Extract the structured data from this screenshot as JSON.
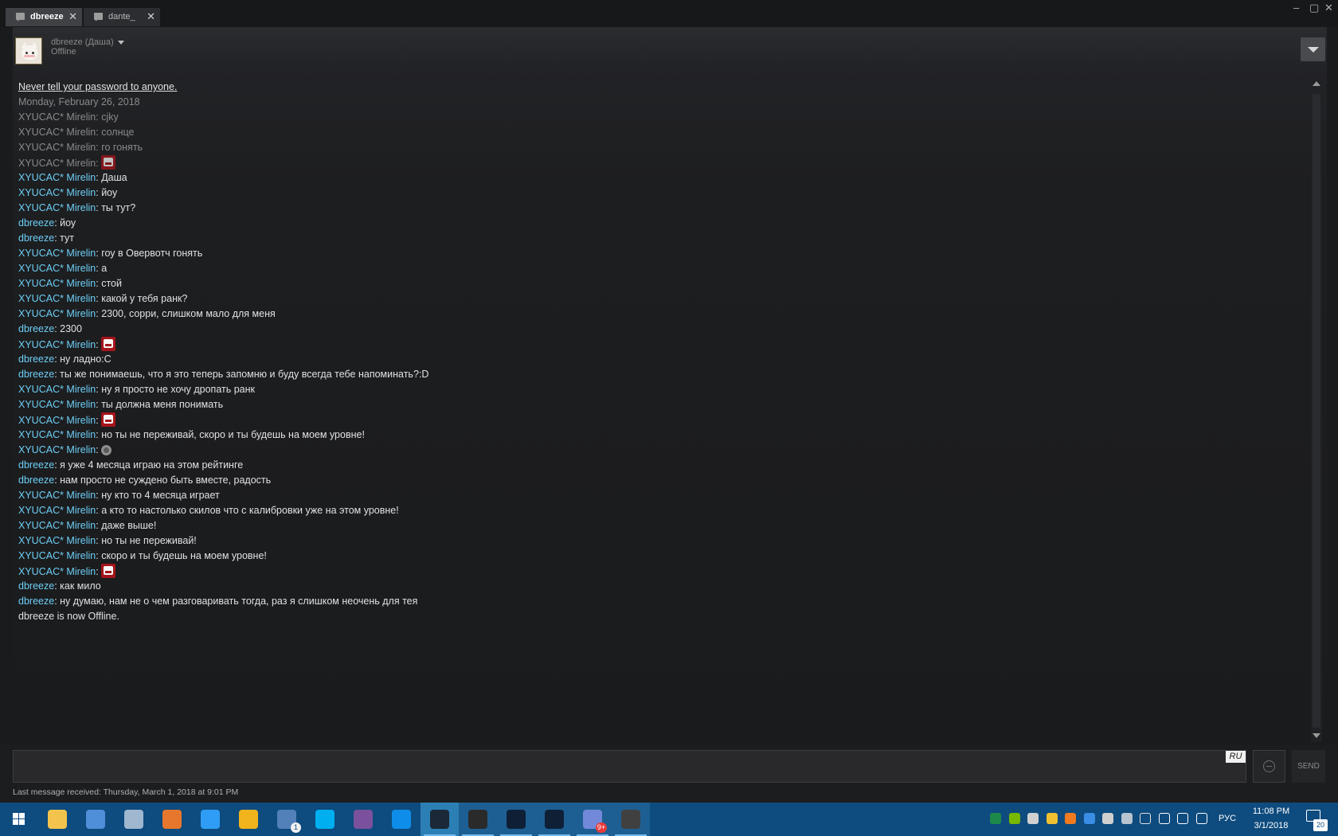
{
  "tabs": [
    {
      "label": "dbreeze",
      "close": "✕"
    },
    {
      "label": "dante_",
      "close": "✕"
    }
  ],
  "window": {
    "minimize": "–",
    "maximize": "▢",
    "close": "✕"
  },
  "friend": {
    "name": "dbreeze (Даша)",
    "status": "Offline"
  },
  "chat": {
    "warning": "Never tell your password to anyone.",
    "date": "Monday, February 26, 2018",
    "messages": [
      {
        "sender": "XYUCAC* Mirelin",
        "text": "cjky",
        "old": true
      },
      {
        "sender": "XYUCAC* Mirelin",
        "text": "солнце",
        "old": true
      },
      {
        "sender": "XYUCAC* Mirelin",
        "text": "го гонять",
        "old": true
      },
      {
        "sender": "XYUCAC* Mirelin",
        "text": "",
        "emote": "meatboy-emote",
        "old": true
      },
      {
        "sender": "XYUCAC* Mirelin",
        "text": "Даша"
      },
      {
        "sender": "XYUCAC* Mirelin",
        "text": "йоу"
      },
      {
        "sender": "XYUCAC* Mirelin",
        "text": "ты тут?"
      },
      {
        "sender": "dbreeze",
        "text": "йоу"
      },
      {
        "sender": "dbreeze",
        "text": "тут"
      },
      {
        "sender": "XYUCAC* Mirelin",
        "text": "гоу в Овервотч гонять"
      },
      {
        "sender": "XYUCAC* Mirelin",
        "text": "а"
      },
      {
        "sender": "XYUCAC* Mirelin",
        "text": "стой"
      },
      {
        "sender": "XYUCAC* Mirelin",
        "text": "какой у тебя ранк?"
      },
      {
        "sender": "XYUCAC* Mirelin",
        "text": "2300, сорри, слишком мало для меня"
      },
      {
        "sender": "dbreeze",
        "text": "2300"
      },
      {
        "sender": "XYUCAC* Mirelin",
        "text": "",
        "emote": "meatboy-emote"
      },
      {
        "sender": "dbreeze",
        "text": "ну ладно:С"
      },
      {
        "sender": "dbreeze",
        "text": "ты же понимаешь, что я это теперь запомню и буду всегда тебе напоминать?:D"
      },
      {
        "sender": "XYUCAC* Mirelin",
        "text": "ну я просто не хочу дропать ранк"
      },
      {
        "sender": "XYUCAC* Mirelin",
        "text": "ты должна меня понимать"
      },
      {
        "sender": "XYUCAC* Mirelin",
        "text": "",
        "emote": "meatboy-emote"
      },
      {
        "sender": "XYUCAC* Mirelin",
        "text": "но ты не переживай, скоро и ты будешь на моем уровне!"
      },
      {
        "sender": "XYUCAC* Mirelin",
        "text": "",
        "emote": "smiley-emote"
      },
      {
        "sender": "dbreeze",
        "text": "я уже 4 месяца играю на этом рейтинге"
      },
      {
        "sender": "dbreeze",
        "text": "нам просто не суждено быть вместе, радость"
      },
      {
        "sender": "XYUCAC* Mirelin",
        "text": "ну кто то 4 месяца играет"
      },
      {
        "sender": "XYUCAC* Mirelin",
        "text": "а кто то настолько скилов что с калибровки уже на этом уровне!"
      },
      {
        "sender": "XYUCAC* Mirelin",
        "text": "даже выше!"
      },
      {
        "sender": "XYUCAC* Mirelin",
        "text": "но ты не переживай!"
      },
      {
        "sender": "XYUCAC* Mirelin",
        "text": "скоро и ты будешь на моем уровне!"
      },
      {
        "sender": "XYUCAC* Mirelin",
        "text": "",
        "emote": "meatboy-emote"
      },
      {
        "sender": "dbreeze",
        "text": "как мило"
      },
      {
        "sender": "dbreeze",
        "text": "ну думаю, нам не о чем разговаривать тогда, раз я слишком неочень для тея"
      }
    ],
    "system": "dbreeze is now Offline."
  },
  "input": {
    "lang": "RU",
    "send_label": "SEND",
    "value": ""
  },
  "footer": {
    "last_message": "Last message received: Thursday, March 1, 2018 at 9:01 PM"
  },
  "taskbar": {
    "apps": [
      {
        "name": "start-button",
        "color": "#ffffff"
      },
      {
        "name": "file-explorer-icon",
        "color": "#f3c44d"
      },
      {
        "name": "film-app-icon",
        "color": "#4f8fd9"
      },
      {
        "name": "qbittorrent-icon",
        "color": "#9fb7cf"
      },
      {
        "name": "firefox-icon",
        "color": "#e8772e"
      },
      {
        "name": "play-icon",
        "color": "#2f9df5"
      },
      {
        "name": "warning-app-icon",
        "color": "#f1b41c"
      },
      {
        "name": "vk-icon",
        "color": "#5181b8",
        "badge": "1"
      },
      {
        "name": "skype-icon",
        "color": "#00aff0"
      },
      {
        "name": "viber-icon",
        "color": "#7b519d"
      },
      {
        "name": "teamviewer-icon",
        "color": "#0e8ee9"
      },
      {
        "name": "steam-icon",
        "color": "#1b2838"
      },
      {
        "name": "game-icon",
        "color": "#2a2a2a"
      },
      {
        "name": "battlenet-icon",
        "color": "#0e1f36"
      },
      {
        "name": "battlenet-launcher-icon",
        "color": "#0e1f36"
      },
      {
        "name": "discord-icon",
        "color": "#7289da",
        "badge": "9+"
      },
      {
        "name": "overwatch-icon",
        "color": "#404040"
      }
    ],
    "tray": [
      "green",
      "nvidia",
      "person",
      "yellow",
      "orange",
      "blue",
      "ru",
      "steam",
      "shield",
      "security",
      "volume",
      "network"
    ],
    "lang": "РУС",
    "time": "11:08 PM",
    "date": "3/1/2018",
    "notifications": "20"
  }
}
